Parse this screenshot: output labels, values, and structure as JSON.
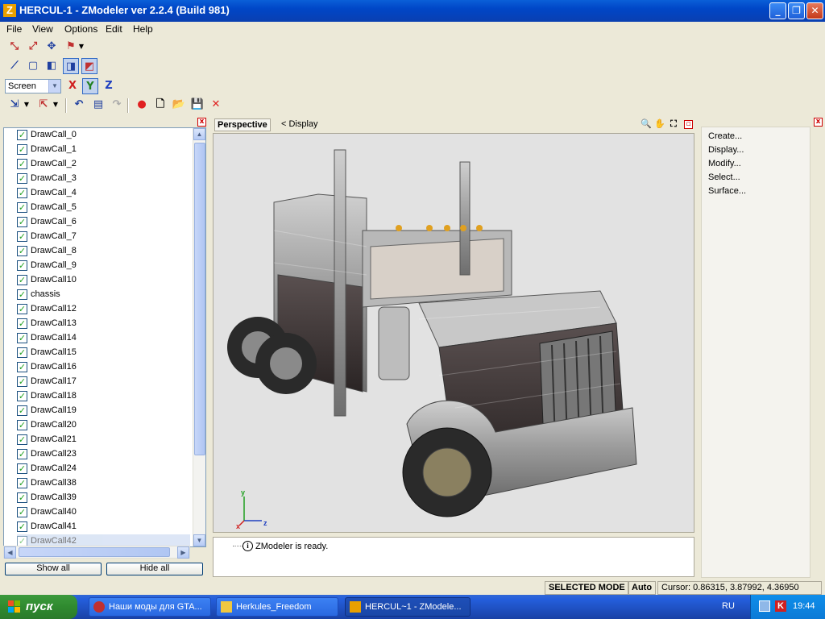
{
  "window": {
    "title": "HERCUL-1 - ZModeler ver 2.2.4 (Build 981)",
    "app_icon": "Z",
    "controls": [
      "minimize-icon",
      "restore-icon",
      "close-icon"
    ]
  },
  "menu": [
    "File",
    "View",
    "Options",
    "Edit",
    "Help"
  ],
  "toolbar": {
    "coord_mode": "Screen",
    "axis_x": "X",
    "axis_y": "Y",
    "axis_z": "Z"
  },
  "object_list": {
    "items": [
      {
        "label": "DrawCall_0",
        "checked": true
      },
      {
        "label": "DrawCall_1",
        "checked": true
      },
      {
        "label": "DrawCall_2",
        "checked": true
      },
      {
        "label": "DrawCall_3",
        "checked": true
      },
      {
        "label": "DrawCall_4",
        "checked": true
      },
      {
        "label": "DrawCall_5",
        "checked": true
      },
      {
        "label": "DrawCall_6",
        "checked": true
      },
      {
        "label": "DrawCall_7",
        "checked": true
      },
      {
        "label": "DrawCall_8",
        "checked": true
      },
      {
        "label": "DrawCall_9",
        "checked": true
      },
      {
        "label": "DrawCall10",
        "checked": true
      },
      {
        "label": "chassis",
        "checked": true
      },
      {
        "label": "DrawCall12",
        "checked": true
      },
      {
        "label": "DrawCall13",
        "checked": true
      },
      {
        "label": "DrawCall14",
        "checked": true
      },
      {
        "label": "DrawCall15",
        "checked": true
      },
      {
        "label": "DrawCall16",
        "checked": true
      },
      {
        "label": "DrawCall17",
        "checked": true
      },
      {
        "label": "DrawCall18",
        "checked": true
      },
      {
        "label": "DrawCall19",
        "checked": true
      },
      {
        "label": "DrawCall20",
        "checked": true
      },
      {
        "label": "DrawCall21",
        "checked": true
      },
      {
        "label": "DrawCall23",
        "checked": true
      },
      {
        "label": "DrawCall24",
        "checked": true
      },
      {
        "label": "DrawCall38",
        "checked": true
      },
      {
        "label": "DrawCall39",
        "checked": true
      },
      {
        "label": "DrawCall40",
        "checked": true
      },
      {
        "label": "DrawCall41",
        "checked": true
      },
      {
        "label": "DrawCall42",
        "checked": true
      }
    ],
    "show_all": "Show all",
    "hide_all": "Hide all"
  },
  "viewport": {
    "view_name": "Perspective",
    "display_label": "< Display",
    "axis_labels": {
      "x": "x",
      "y": "y",
      "z": "z"
    }
  },
  "console": {
    "message": "ZModeler is ready."
  },
  "right_menu": [
    "Create...",
    "Display...",
    "Modify...",
    "Select...",
    "Surface..."
  ],
  "status": {
    "mode": "SELECTED MODE",
    "auto": "Auto",
    "cursor": "Cursor: 0.86315, 3.87992, 4.36950"
  },
  "taskbar": {
    "start": "пуск",
    "tasks": [
      {
        "label": "Наши моды для GTA...",
        "active": false
      },
      {
        "label": "Herkules_Freedom",
        "active": false
      },
      {
        "label": "HERCUL~1 - ZModele...",
        "active": true
      }
    ],
    "language": "RU",
    "clock": "19:44"
  }
}
